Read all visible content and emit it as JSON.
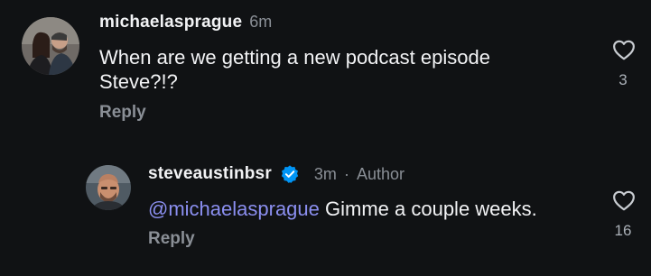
{
  "comments": [
    {
      "username": "michaelasprague",
      "time": "6m",
      "text": "When are we getting a new podcast episode Steve?!?",
      "reply_label": "Reply",
      "like_count": "3"
    }
  ],
  "reply": {
    "username": "steveaustinbsr",
    "verified": true,
    "time": "3m",
    "separator": "·",
    "author_label": "Author",
    "mention": "@michaelasprague",
    "text": " Gimme a couple weeks.",
    "reply_label": "Reply",
    "like_count": "16"
  },
  "colors": {
    "background": "#101214",
    "text": "#f2f3f5",
    "muted": "#8a8f96",
    "mention": "#8b8ff0",
    "verified": "#0095f6"
  },
  "icons": {
    "like": "heart-outline-icon",
    "verified": "verified-badge-icon"
  }
}
